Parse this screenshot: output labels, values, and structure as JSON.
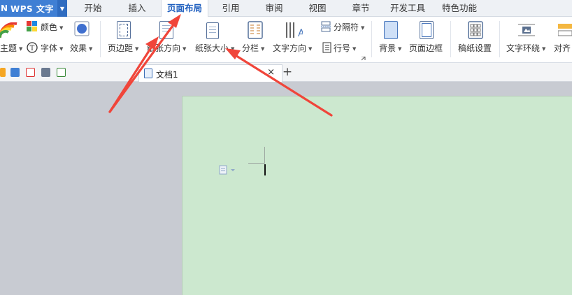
{
  "app": {
    "logo_fragment": "N",
    "title": "WPS 文字"
  },
  "tabs": [
    {
      "label": "开始",
      "active": false
    },
    {
      "label": "插入",
      "active": false
    },
    {
      "label": "页面布局",
      "active": true
    },
    {
      "label": "引用",
      "active": false
    },
    {
      "label": "审阅",
      "active": false
    },
    {
      "label": "视图",
      "active": false
    },
    {
      "label": "章节",
      "active": false
    },
    {
      "label": "开发工具",
      "active": false
    },
    {
      "label": "特色功能",
      "active": false
    }
  ],
  "ribbon": {
    "theme": "主题",
    "colors": "颜色",
    "fonts": "字体",
    "effects": "效果",
    "margins": "页边距",
    "orientation": "纸张方向",
    "size": "纸张大小",
    "columns": "分栏",
    "text_direction": "文字方向",
    "breaks": "分隔符",
    "line_numbers": "行号",
    "background": "背景",
    "page_borders": "页面边框",
    "manuscript": "稿纸设置",
    "wrap_text": "文字环绕",
    "align": "对齐"
  },
  "document": {
    "tab_label": "文档1",
    "close_glyph": "×",
    "new_tab_glyph": "+"
  },
  "colors": {
    "accent": "#3f7fd4",
    "page_bg": "#cce8cf",
    "annotation": "#f0453a"
  }
}
